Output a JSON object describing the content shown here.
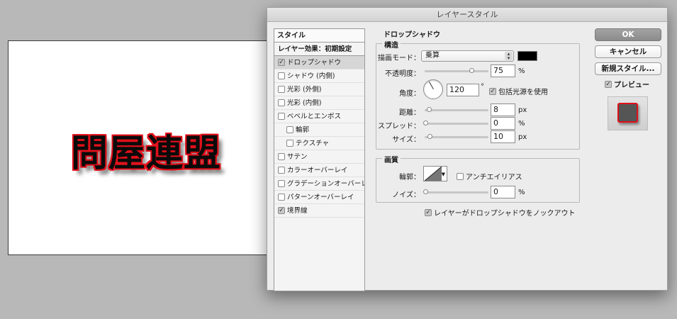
{
  "canvas": {
    "text": "問屋連盟"
  },
  "dialog": {
    "title": "レイヤースタイル"
  },
  "style_list": {
    "header": "スタイル",
    "defaults": "レイヤー効果：初期設定",
    "items": [
      {
        "label": "ドロップシャドウ",
        "checked": true,
        "selected": true,
        "sub": false
      },
      {
        "label": "シャドウ (内側)",
        "checked": false,
        "sub": false
      },
      {
        "label": "光彩 (外側)",
        "checked": false,
        "sub": false
      },
      {
        "label": "光彩 (内側)",
        "checked": false,
        "sub": false
      },
      {
        "label": "ベベルとエンボス",
        "checked": false,
        "sub": false
      },
      {
        "label": "輪郭",
        "checked": false,
        "sub": true
      },
      {
        "label": "テクスチャ",
        "checked": false,
        "sub": true
      },
      {
        "label": "サテン",
        "checked": false,
        "sub": false
      },
      {
        "label": "カラーオーバーレイ",
        "checked": false,
        "sub": false
      },
      {
        "label": "グラデーションオーバーレイ",
        "checked": false,
        "sub": false
      },
      {
        "label": "パターンオーバーレイ",
        "checked": false,
        "sub": false
      },
      {
        "label": "境界線",
        "checked": true,
        "sub": false
      }
    ]
  },
  "drop_shadow": {
    "section_title": "ドロップシャドウ",
    "structure": {
      "title": "構造",
      "blend_mode_label": "描画モード：",
      "blend_mode_value": "乗算",
      "blend_color": "#000000",
      "opacity_label": "不透明度：",
      "opacity_value": "75",
      "opacity_unit": "%",
      "angle_label": "角度：",
      "angle_value": "120",
      "angle_unit": "°",
      "global_light_label": "包括光源を使用",
      "global_light_checked": true,
      "distance_label": "距離：",
      "distance_value": "8",
      "distance_unit": "px",
      "spread_label": "スプレッド：",
      "spread_value": "0",
      "spread_unit": "%",
      "size_label": "サイズ：",
      "size_value": "10",
      "size_unit": "px"
    },
    "quality": {
      "title": "画質",
      "contour_label": "輪郭：",
      "anti_alias_label": "アンチエイリアス",
      "anti_alias_checked": false,
      "noise_label": "ノイズ：",
      "noise_value": "0",
      "noise_unit": "%"
    },
    "knockout_label": "レイヤーがドロップシャドウをノックアウト",
    "knockout_checked": true
  },
  "buttons": {
    "ok": "OK",
    "cancel": "キャンセル",
    "new_style": "新規スタイル...",
    "preview_label": "プレビュー",
    "preview_checked": true
  },
  "colors": {
    "stroke": "#e0101a",
    "shadow": "#000000"
  }
}
